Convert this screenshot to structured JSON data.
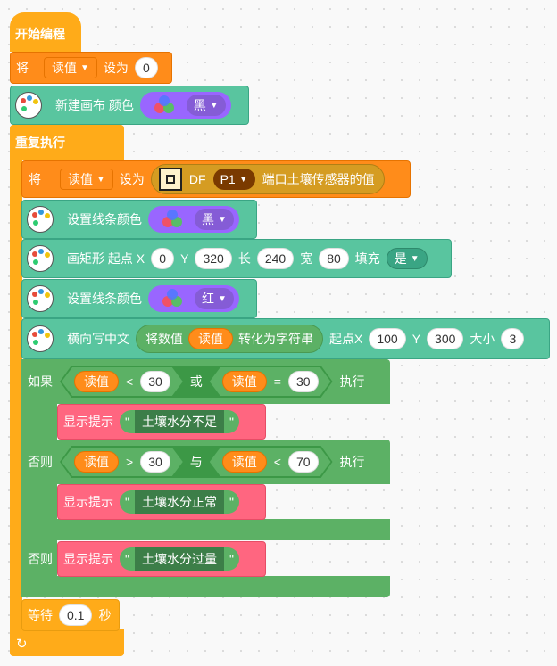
{
  "hat": {
    "label": "开始编程"
  },
  "set_block": {
    "prefix": "将",
    "variable": "读值",
    "middle": "设为",
    "value": "0"
  },
  "canvas_block": {
    "label": "新建画布 颜色",
    "color": "黑"
  },
  "repeat_block": {
    "label": "重复执行"
  },
  "sensor_block": {
    "prefix": "将",
    "variable": "读值",
    "middle": "设为",
    "device": "DF",
    "port": "P1",
    "suffix": "端口土壤传感器的值"
  },
  "line_color_1": {
    "label": "设置线条颜色",
    "color": "黑"
  },
  "rect_block": {
    "label": "画矩形 起点 X",
    "x": "0",
    "y_label": "Y",
    "y": "320",
    "len_label": "长",
    "len": "240",
    "width_label": "宽",
    "width": "80",
    "fill_label": "填充",
    "fill": "是"
  },
  "line_color_2": {
    "label": "设置线条颜色",
    "color": "红"
  },
  "text_block": {
    "label": "横向写中文",
    "convert_prefix": "将数值",
    "convert_var": "读值",
    "convert_suffix": "转化为字符串",
    "x_label": "起点X",
    "x": "100",
    "y_label": "Y",
    "y": "300",
    "size_label": "大小",
    "size": "3"
  },
  "if_block": {
    "if_label": "如果",
    "cond1": {
      "var": "读值",
      "op": "<",
      "val": "30"
    },
    "join1": "或",
    "cond2": {
      "var": "读值",
      "op": "=",
      "val": "30"
    },
    "exec_label": "执行",
    "tip1": {
      "label": "显示提示",
      "text": "土壤水分不足"
    },
    "elseif_label": "否则",
    "cond3": {
      "var": "读值",
      "op": ">",
      "val": "30"
    },
    "join2": "与",
    "cond4": {
      "var": "读值",
      "op": "<",
      "val": "70"
    },
    "exec_label2": "执行",
    "tip2": {
      "label": "显示提示",
      "text": "土壤水分正常"
    },
    "else_label": "否则",
    "tip3": {
      "label": "显示提示",
      "text": "土壤水分过量"
    }
  },
  "wait_block": {
    "label": "等待",
    "value": "0.1",
    "unit": "秒"
  },
  "icons": {
    "loop": "loop-arrow-icon",
    "palette": "palette-icon",
    "chip": "sensor-chip-icon",
    "rgb": "rgb-circles-icon"
  },
  "colors": {
    "event": "#ffab19",
    "variable": "#ff8c1a",
    "pen": "#59c59f",
    "control": "#5cb165",
    "looks": "#ff6680",
    "color_picker": "#9966ff"
  }
}
